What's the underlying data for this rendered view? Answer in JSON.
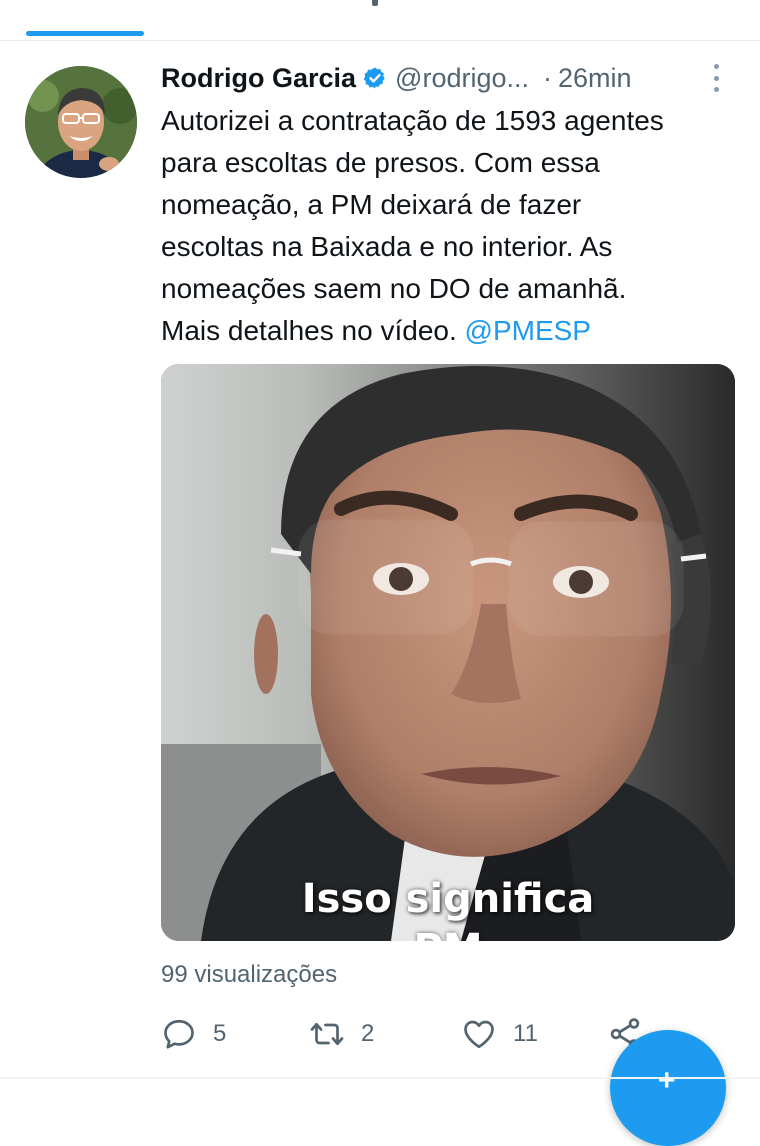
{
  "tweet": {
    "author_name": "Rodrigo Garcia",
    "handle": "@rodrigo...",
    "separator": "·",
    "time": "26min",
    "text_lines": [
      "Autorizei a contratação de 1593 agentes",
      "para escoltas de presos. Com essa",
      "nomeação, a PM deixará de fazer",
      "escoltas na Baixada e no interior. As",
      "nomeações saem no DO de amanhã.",
      "Mais detalhes no vídeo. "
    ],
    "mention": "@PMESP",
    "video_caption": "Isso significa",
    "video_caption_next": "PM",
    "views": "99 visualizações"
  },
  "actions": {
    "reply_count": "5",
    "retweet_count": "2",
    "like_count": "11"
  },
  "colors": {
    "accent": "#1d9bf0",
    "text": "#0f1419",
    "secondary": "#536471"
  },
  "icons": [
    "verified-badge-icon",
    "more-options-icon",
    "reply-icon",
    "retweet-icon",
    "like-icon",
    "share-icon",
    "compose-plus-icon"
  ]
}
